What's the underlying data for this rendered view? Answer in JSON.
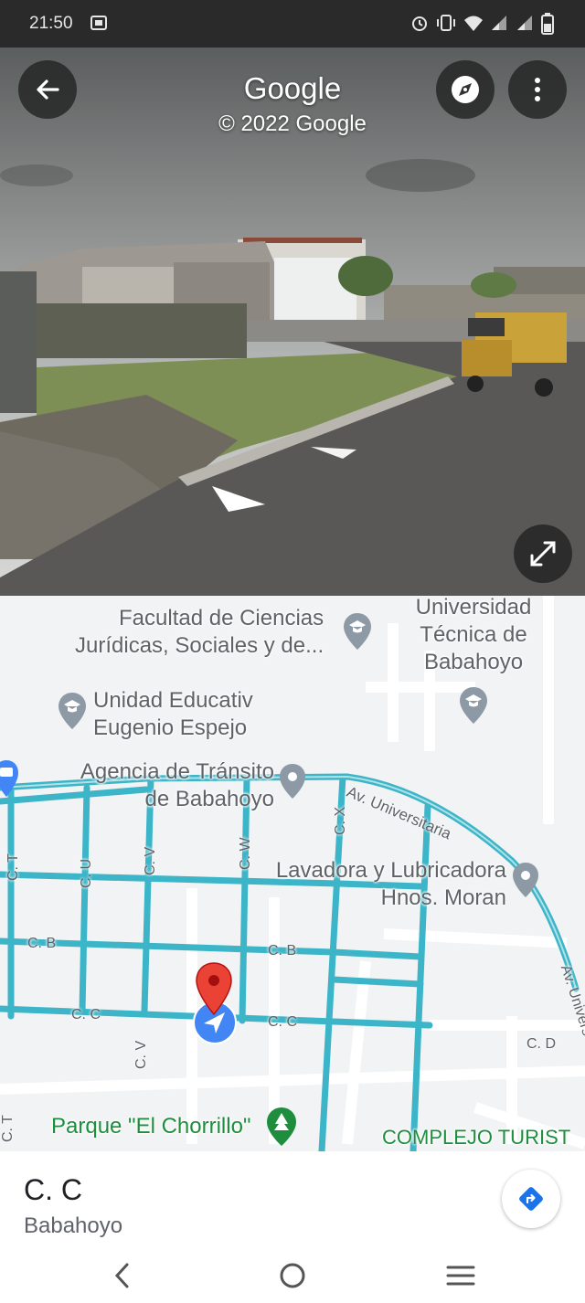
{
  "status_bar": {
    "time": "21:50",
    "icons": [
      "teams-icon",
      "alarm-icon",
      "vibrate-icon",
      "wifi-icon",
      "signal-icon",
      "signal-icon",
      "battery-icon"
    ]
  },
  "street_view": {
    "title": "Google",
    "copyright": "© 2022 Google",
    "buttons": [
      "back-arrow-icon",
      "compass-icon",
      "more-vert-icon",
      "expand-icon"
    ]
  },
  "map": {
    "places": {
      "facultad": [
        "Facultad de Ciencias",
        "Jurídicas, Sociales y de..."
      ],
      "universidad": [
        "Universidad",
        "Técnica de",
        "Babahoyo"
      ],
      "unidad": [
        "Unidad Educativ",
        "Eugenio Espejo"
      ],
      "agencia": [
        "Agencia de Tránsito",
        "de Babahoyo"
      ],
      "lavadora": [
        "Lavadora y Lubricadora",
        "Hnos. Moran"
      ],
      "parque": "Parque \"El Chorrillo\"",
      "complejo": "COMPLEJO TURIST"
    },
    "streets": {
      "av_universitaria": "Av. Universitaria",
      "av_univers_right": "Av. Univers",
      "ct": "C. T",
      "ct2": "C. T",
      "cu": "C. U",
      "cv": "C. V",
      "cv2": "C. V",
      "cw": "C. W",
      "cx": "C. X",
      "cb_left": "C. B",
      "cb_mid": "C. B",
      "cc_left": "C. C",
      "cc_mid": "C. C",
      "cd": "C. D"
    },
    "colors": {
      "street_view_line": "#3cb5c8",
      "pin": "#ea4335",
      "location": "#4285f4",
      "park": "#1e8e3e"
    }
  },
  "bottom_sheet": {
    "place_name": "C. C",
    "city": "Babahoyo",
    "directions_icon": "directions-icon"
  },
  "nav_bar": {
    "buttons": [
      "nav-back-icon",
      "nav-home-icon",
      "nav-recents-icon"
    ]
  }
}
